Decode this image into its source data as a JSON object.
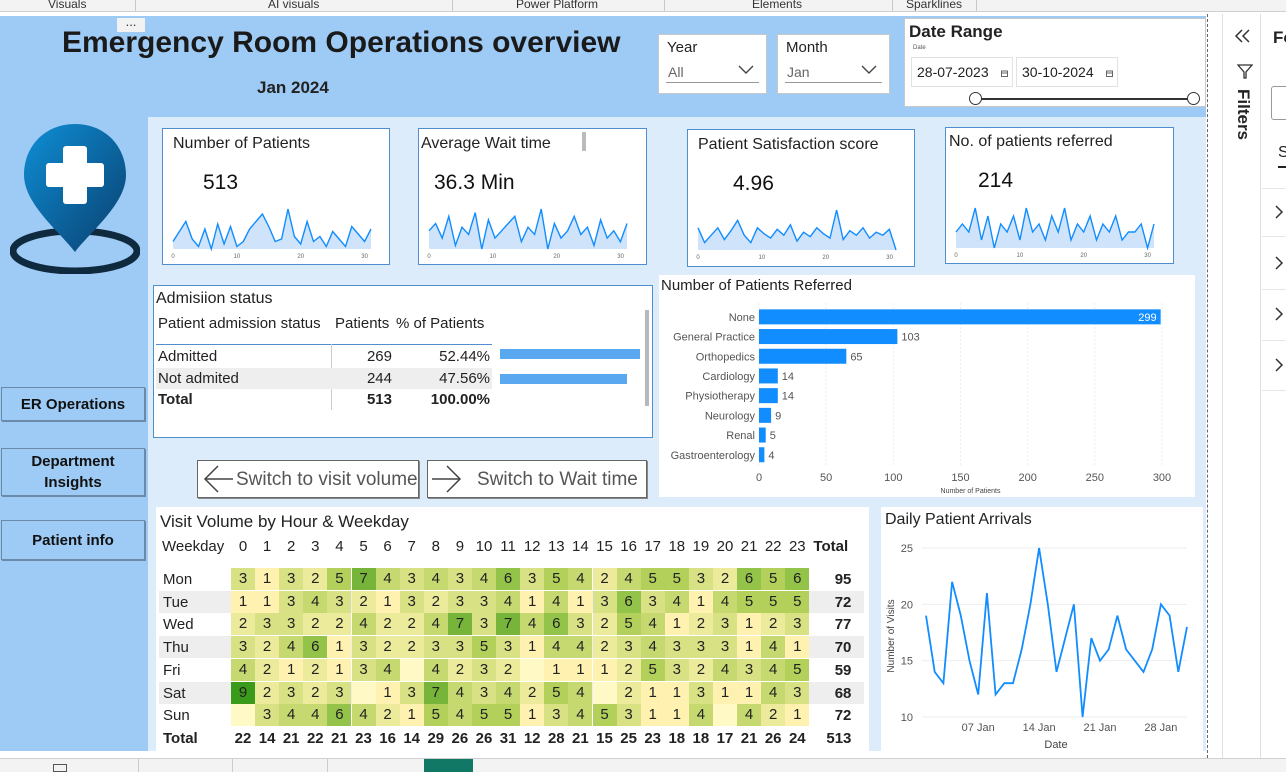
{
  "ribbon": {
    "tabs": [
      "Visuals",
      "AI visuals",
      "Power Platform",
      "Elements",
      "Sparklines"
    ]
  },
  "report": {
    "title": "Emergency Room Operations overview",
    "subtitle": "Jan 2024",
    "more_options": "..."
  },
  "slicers": {
    "year": {
      "title": "Year",
      "value": "All"
    },
    "month": {
      "title": "Month",
      "value": "Jan"
    },
    "date_range": {
      "title": "Date Range",
      "caption": "Date",
      "start": "28-07-2023",
      "end": "30-10-2024"
    }
  },
  "nav": {
    "er_operations": "ER Operations",
    "department_insights_1": "Department",
    "department_insights_2": "Insights",
    "patient_info": "Patient info"
  },
  "kpis": [
    {
      "title": "Number of Patients",
      "value": "513",
      "values": [
        14,
        18,
        22,
        15,
        12,
        19,
        11,
        21,
        13,
        20,
        12,
        14,
        19,
        22,
        25,
        20,
        14,
        15,
        27,
        16,
        13,
        22,
        14,
        16,
        12,
        18,
        15,
        12,
        20,
        17,
        14,
        19
      ],
      "ticks": [
        "0",
        "10",
        "20",
        "30"
      ]
    },
    {
      "title": "Average Wait time",
      "value": "36.3 Min",
      "values": [
        38,
        40,
        36,
        42,
        34,
        39,
        37,
        43,
        33,
        41,
        36,
        38,
        40,
        42,
        35,
        39,
        37,
        44,
        33,
        40,
        36,
        38,
        42,
        37,
        39,
        34,
        41,
        36,
        38,
        35,
        40
      ],
      "ticks": [
        "0",
        "10",
        "20",
        "30"
      ]
    },
    {
      "title": "Patient Satisfaction score",
      "value": "4.96",
      "values": [
        5.0,
        4.9,
        4.95,
        5.0,
        4.92,
        4.98,
        5.05,
        4.95,
        4.9,
        5.0,
        4.96,
        4.93,
        4.99,
        4.95,
        5.02,
        4.91,
        4.97,
        4.94,
        5.0,
        4.96,
        4.93,
        5.12,
        4.92,
        4.98,
        4.95,
        5.0,
        4.93,
        4.97,
        4.95,
        4.99,
        4.85
      ],
      "ticks": [
        "0",
        "10",
        "20",
        "30"
      ]
    },
    {
      "title": "No. of patients referred",
      "value": "214",
      "values": [
        7,
        8,
        7,
        10,
        6,
        9,
        5,
        8,
        7,
        9,
        6,
        10,
        7,
        8,
        6,
        9,
        7,
        10,
        6,
        8,
        7,
        9,
        6,
        8,
        7,
        9,
        6,
        7,
        7,
        8,
        5,
        8
      ],
      "ticks": [
        "0",
        "10",
        "20",
        "30"
      ]
    }
  ],
  "admission": {
    "title": "Admisiion status",
    "headers": [
      "Patient admission status",
      "Patients",
      "% of Patients"
    ],
    "rows": [
      {
        "status": "Admitted",
        "patients": "269",
        "pct": "52.44%",
        "fraction": 0.5244
      },
      {
        "status": "Not admited",
        "patients": "244",
        "pct": "47.56%",
        "fraction": 0.4756
      }
    ],
    "total": {
      "label": "Total",
      "patients": "513",
      "pct": "100.00%"
    }
  },
  "switch_buttons": {
    "visit_volume": "Switch to visit volume",
    "wait_time": "Switch to Wait time"
  },
  "chart_data": [
    {
      "type": "bar",
      "title": "Number of Patients Referred",
      "categories": [
        "None",
        "General Practice",
        "Orthopedics",
        "Cardiology",
        "Physiotherapy",
        "Neurology",
        "Renal",
        "Gastroenterology"
      ],
      "values": [
        299,
        103,
        65,
        14,
        14,
        9,
        5,
        4
      ],
      "xlabel": "Number of Patients",
      "xlim": [
        0,
        300
      ],
      "xticks": [
        0,
        50,
        100,
        150,
        200,
        250,
        300
      ],
      "grid": true,
      "color": "#118dff"
    },
    {
      "type": "line",
      "title": "Daily Patient Arrivals",
      "xlabel": "Date",
      "ylabel": "Number of Visits",
      "ylim": [
        10,
        25
      ],
      "yticks": [
        10,
        15,
        20,
        25
      ],
      "xtick_labels": [
        "07 Jan",
        "14 Jan",
        "21 Jan",
        "28 Jan"
      ],
      "xtick_days": [
        7,
        14,
        21,
        28
      ],
      "x_days": [
        1,
        2,
        3,
        4,
        5,
        6,
        7,
        8,
        9,
        10,
        11,
        12,
        13,
        14,
        15,
        16,
        17,
        18,
        19,
        20,
        21,
        22,
        23,
        24,
        25,
        26,
        27,
        28,
        29,
        30,
        31
      ],
      "values": [
        19,
        14,
        13,
        22,
        19,
        15,
        12,
        21,
        12,
        13,
        13,
        16,
        20,
        25,
        20,
        14,
        17,
        20,
        10,
        17,
        15,
        16,
        19,
        16,
        15,
        14,
        16,
        20,
        19,
        14,
        18
      ],
      "color": "#118dff"
    },
    {
      "type": "heatmap",
      "title": "Visit Volume by Hour & Weekday",
      "row_header": "Weekday",
      "total_label": "Total",
      "columns": [
        "0",
        "1",
        "2",
        "3",
        "4",
        "5",
        "6",
        "7",
        "8",
        "9",
        "10",
        "11",
        "12",
        "13",
        "14",
        "15",
        "16",
        "17",
        "18",
        "19",
        "20",
        "21",
        "22",
        "23"
      ],
      "rows": [
        "Mon",
        "Tue",
        "Wed",
        "Thu",
        "Fri",
        "Sat",
        "Sun"
      ],
      "cells": [
        [
          "3",
          "1",
          "3",
          "2",
          "5",
          "7",
          "4",
          "3",
          "4",
          "3",
          "4",
          "6",
          "3",
          "5",
          "4",
          "2",
          "4",
          "5",
          "5",
          "3",
          "2",
          "6",
          "5",
          "6"
        ],
        [
          "1",
          "1",
          "3",
          "4",
          "3",
          "2",
          "1",
          "3",
          "2",
          "3",
          "3",
          "4",
          "1",
          "4",
          "1",
          "3",
          "6",
          "3",
          "4",
          "1",
          "4",
          "5",
          "5",
          "5"
        ],
        [
          "2",
          "3",
          "3",
          "2",
          "2",
          "4",
          "2",
          "2",
          "4",
          "7",
          "3",
          "7",
          "4",
          "6",
          "3",
          "2",
          "5",
          "4",
          "1",
          "2",
          "3",
          "1",
          "2",
          "3"
        ],
        [
          "3",
          "2",
          "4",
          "6",
          "1",
          "3",
          "2",
          "2",
          "3",
          "3",
          "5",
          "3",
          "1",
          "4",
          "4",
          "2",
          "3",
          "4",
          "3",
          "3",
          "3",
          "1",
          "4",
          "1"
        ],
        [
          "4",
          "2",
          "1",
          "2",
          "1",
          "3",
          "4",
          "",
          "4",
          "2",
          "3",
          "2",
          "",
          "1",
          "1",
          "1",
          "2",
          "5",
          "3",
          "2",
          "4",
          "3",
          "4",
          "5"
        ],
        [
          "9",
          "2",
          "3",
          "2",
          "3",
          "",
          "1",
          "3",
          "7",
          "4",
          "3",
          "4",
          "2",
          "5",
          "4",
          "",
          "2",
          "1",
          "1",
          "3",
          "1",
          "1",
          "4",
          "3"
        ],
        [
          "",
          "3",
          "4",
          "4",
          "6",
          "4",
          "2",
          "1",
          "5",
          "4",
          "5",
          "5",
          "1",
          "3",
          "4",
          "5",
          "3",
          "1",
          "1",
          "4",
          "",
          "4",
          "2",
          "1"
        ]
      ],
      "row_totals": [
        "95",
        "72",
        "77",
        "70",
        "59",
        "68",
        "72"
      ],
      "col_totals": [
        "22",
        "14",
        "21",
        "22",
        "21",
        "23",
        "16",
        "14",
        "29",
        "26",
        "26",
        "31",
        "12",
        "28",
        "21",
        "15",
        "25",
        "23",
        "18",
        "18",
        "17",
        "21",
        "26",
        "24"
      ],
      "grand_total": "513",
      "scale": {
        "min": 1,
        "max": 9,
        "low_color": "#fff2b0",
        "high_color": "#3a9a1a"
      }
    }
  ],
  "filters_pane": {
    "title": "Filters",
    "partial_title": "Fo",
    "partial_tab": "S"
  }
}
